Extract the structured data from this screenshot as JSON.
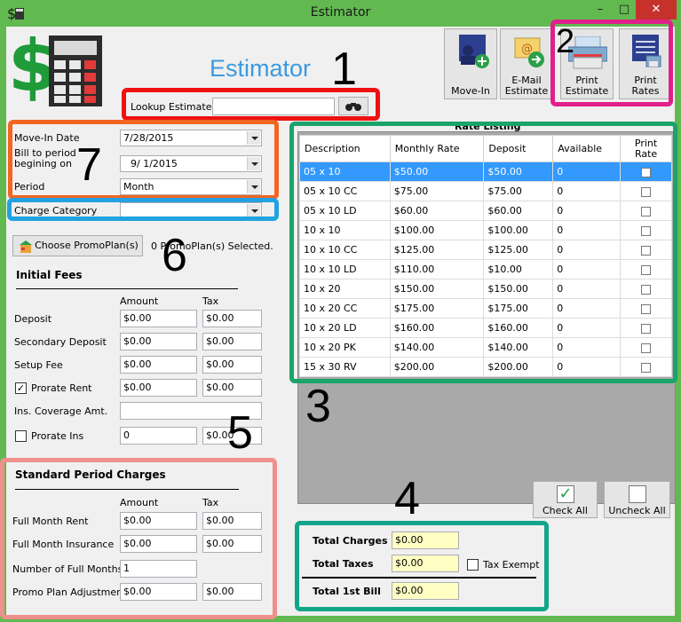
{
  "window": {
    "title": "Estimator",
    "minimize": "–",
    "maximize": "□",
    "close": "✕"
  },
  "logo": {
    "dollar": "$"
  },
  "header": {
    "title": "Estimator"
  },
  "toolbar": {
    "move_in": "Move-In",
    "email_line1": "E-Mail",
    "email_line2": "Estimate",
    "print_estimate_line1": "Print",
    "print_estimate_line2": "Estimate",
    "print_rates_line1": "Print",
    "print_rates_line2": "Rates"
  },
  "lookup": {
    "label": "Lookup Estimate",
    "value": ""
  },
  "dates": {
    "move_in_label": "Move-In Date",
    "move_in_value": "7/28/2015",
    "bill_label_line1": "Bill to period",
    "bill_label_line2": "begining on",
    "bill_value": "9/  1/2015",
    "period_label": "Period",
    "period_value": "Month",
    "charge_category_label": "Charge Category",
    "charge_category_value": ""
  },
  "promo": {
    "button": "Choose PromoPlan(s)",
    "status": "0 PromoPlan(s) Selected."
  },
  "initial_fees": {
    "heading": "Initial Fees",
    "amount_header": "Amount",
    "tax_header": "Tax",
    "deposit_label": "Deposit",
    "deposit_amount": "$0.00",
    "deposit_tax": "$0.00",
    "secondary_label": "Secondary Deposit",
    "secondary_amount": "$0.00",
    "secondary_tax": "$0.00",
    "setup_label": "Setup Fee",
    "setup_amount": "$0.00",
    "setup_tax": "$0.00",
    "prorate_rent_label": "Prorate Rent",
    "prorate_rent_checked": "✓",
    "prorate_rent_amount": "$0.00",
    "prorate_rent_tax": "$0.00",
    "coverage_label": "Ins. Coverage Amt.",
    "coverage_value": "",
    "prorate_ins_label": "Prorate Ins",
    "prorate_ins_amount": "0",
    "prorate_ins_tax": "$0.00"
  },
  "standard": {
    "heading": "Standard Period Charges",
    "amount_header": "Amount",
    "tax_header": "Tax",
    "rent_label": "Full Month Rent",
    "rent_amount": "$0.00",
    "rent_tax": "$0.00",
    "insurance_label": "Full Month Insurance",
    "insurance_amount": "$0.00",
    "insurance_tax": "$0.00",
    "months_label": "Number of Full Months",
    "months_value": "1",
    "promo_label": "Promo Plan Adjustments",
    "promo_amount": "$0.00",
    "promo_tax": "$0.00"
  },
  "rate_listing": {
    "title": "Rate Listing",
    "headers": [
      "Description",
      "Monthly Rate",
      "Deposit",
      "Available",
      "Print",
      "Rate"
    ],
    "rows": [
      [
        "05 x 10",
        "$50.00",
        "$50.00",
        "0"
      ],
      [
        "05 x 10 CC",
        "$75.00",
        "$75.00",
        "0"
      ],
      [
        "05 x 10 LD",
        "$60.00",
        "$60.00",
        "0"
      ],
      [
        "10 x 10",
        "$100.00",
        "$100.00",
        "0"
      ],
      [
        "10 x 10 CC",
        "$125.00",
        "$125.00",
        "0"
      ],
      [
        "10 x 10 LD",
        "$110.00",
        "$10.00",
        "0"
      ],
      [
        "10 x 20",
        "$150.00",
        "$150.00",
        "0"
      ],
      [
        "10 x 20 CC",
        "$175.00",
        "$175.00",
        "0"
      ],
      [
        "10 x 20 LD",
        "$160.00",
        "$160.00",
        "0"
      ],
      [
        "10 x 20 PK",
        "$140.00",
        "$140.00",
        "0"
      ],
      [
        "15 x 30 RV",
        "$200.00",
        "$200.00",
        "0"
      ]
    ]
  },
  "check_buttons": {
    "check_all": "Check All",
    "uncheck_all": "Uncheck All",
    "check_mark": "✓"
  },
  "totals": {
    "charges_label": "Total Charges",
    "charges_value": "$0.00",
    "taxes_label": "Total Taxes",
    "taxes_value": "$0.00",
    "tax_exempt_label": "Tax Exempt",
    "first_bill_label": "Total 1st Bill",
    "first_bill_value": "$0.00"
  },
  "annotations": {
    "n1": "1",
    "n2": "2",
    "n3": "3",
    "n4": "4",
    "n5": "5",
    "n6": "6",
    "n7": "7"
  },
  "colors": {
    "titlebar": "#62b950",
    "selected_row": "#3399ff",
    "red": "#ee1111",
    "magenta": "#e0208a",
    "green": "#1aa36a",
    "orange": "#f26522",
    "blue": "#22a3e0",
    "pink": "#f0908c",
    "teal": "#13a58a"
  }
}
